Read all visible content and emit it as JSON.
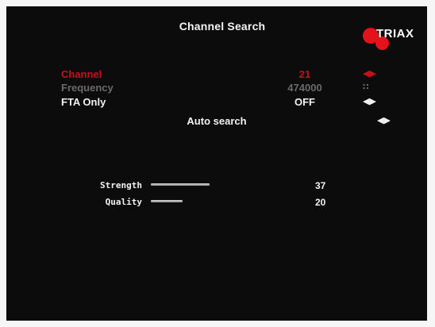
{
  "menu": {
    "title": "Channel Search",
    "logo_text": "TRIAX",
    "brand_color": "#e4131b",
    "accent_color": "#c8101c",
    "rows": [
      {
        "label": "Channel",
        "value": "21",
        "control": "◀▶",
        "state": "active"
      },
      {
        "label": "Frequency",
        "value": "474000",
        "control": "∷",
        "state": "disabled"
      },
      {
        "label": "FTA Only",
        "value": "OFF",
        "control": "◀▶",
        "state": "normal"
      }
    ],
    "auto_search": {
      "label": "Auto search",
      "control": "◀▶"
    }
  },
  "signal": {
    "strength": {
      "label": "Strength",
      "value": "37",
      "level": 37
    },
    "quality": {
      "label": "Quality",
      "value": "20",
      "level": 20
    }
  }
}
